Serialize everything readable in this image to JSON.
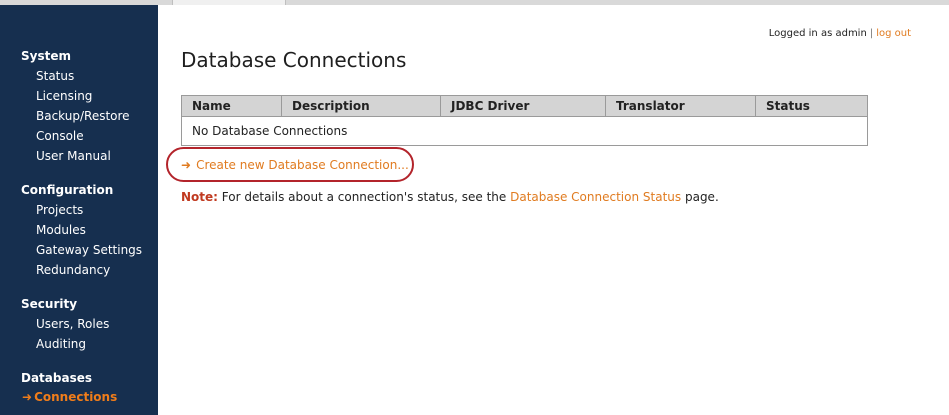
{
  "header": {
    "logged_in_text": "Logged in as admin",
    "separator": "|",
    "logout_label": "log out"
  },
  "sidebar": {
    "groups": [
      {
        "title": "System",
        "items": [
          "Status",
          "Licensing",
          "Backup/Restore",
          "Console",
          "User Manual"
        ]
      },
      {
        "title": "Configuration",
        "items": [
          "Projects",
          "Modules",
          "Gateway Settings",
          "Redundancy"
        ]
      },
      {
        "title": "Security",
        "items": [
          "Users, Roles",
          "Auditing"
        ]
      },
      {
        "title": "Databases",
        "items": [
          "Connections"
        ]
      }
    ],
    "active_item": "Connections",
    "active_marker": "➜"
  },
  "main": {
    "title": "Database Connections",
    "table": {
      "columns": [
        "Name",
        "Description",
        "JDBC Driver",
        "Translator",
        "Status"
      ],
      "empty_text": "No Database Connections"
    },
    "create_link": {
      "icon": "arrow-right-icon",
      "label": "Create new Database Connection..."
    },
    "note": {
      "label": "Note:",
      "text_before": "For details about a connection's status, see the",
      "link": "Database Connection Status",
      "text_after": "page."
    }
  },
  "colors": {
    "sidebar_bg": "#162f4f",
    "accent_orange": "#e07b20",
    "note_red": "#c0391f",
    "highlight_oval": "#b3242b",
    "table_header_bg": "#d4d4d4"
  }
}
